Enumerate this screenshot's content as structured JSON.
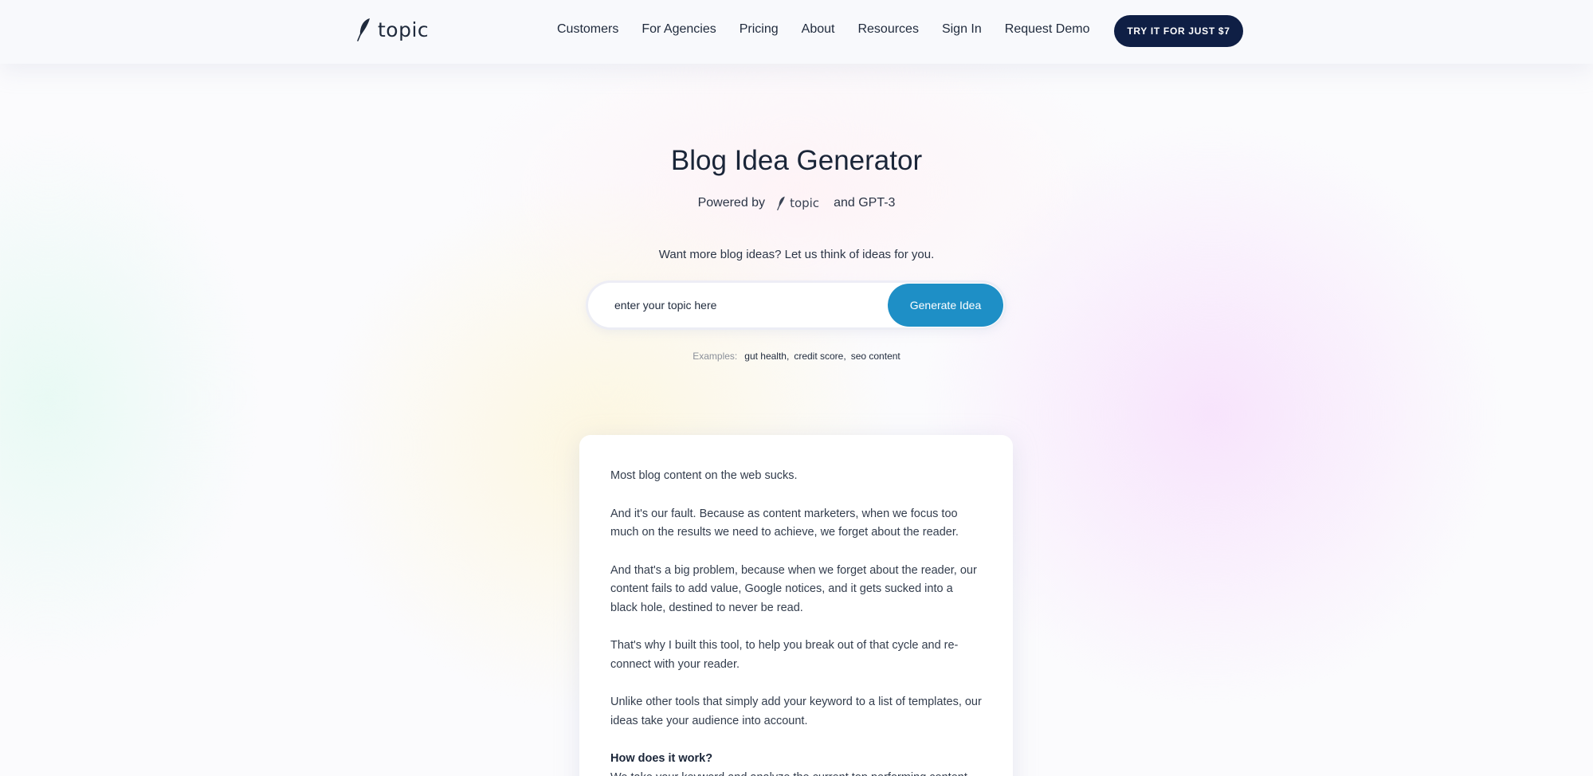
{
  "nav": {
    "logo_text": "topic",
    "links": [
      "Customers",
      "For Agencies",
      "Pricing",
      "About",
      "Resources",
      "Sign In",
      "Request Demo"
    ],
    "cta_label": "TRY IT FOR JUST $7"
  },
  "hero": {
    "title": "Blog Idea Generator",
    "powered_prefix": "Powered by",
    "powered_logo": "topic",
    "powered_suffix": "and GPT-3",
    "tagline": "Want more blog ideas? Let us think of ideas for you."
  },
  "search": {
    "placeholder": "enter your topic here",
    "value": "",
    "button_label": "Generate Idea"
  },
  "examples": {
    "label": "Examples:",
    "items": [
      "gut health",
      "credit score",
      "seo content"
    ]
  },
  "article": {
    "paragraphs": [
      "Most blog content on the web sucks.",
      "And it's our fault. Because as content marketers, when we focus too much on the results we need to achieve, we forget about the reader.",
      "And that's a big problem, because when we forget about the reader, our content fails to add value, Google notices, and it gets sucked into a black hole, destined to never be read.",
      "That's why I built this tool, to help you break out of that cycle and re-connect with your reader.",
      "Unlike other tools that simply add your keyword to a list of templates, our ideas take your audience into account."
    ],
    "heading": "How does it work?",
    "continuation": "We take your keyword and analyze the current top performing content"
  },
  "colors": {
    "cta_bg": "#0f1f45",
    "generate_bg": "#1e8fc6",
    "text_primary": "#1f2a3c"
  },
  "icons": {
    "logo": "feather-quill-icon"
  }
}
